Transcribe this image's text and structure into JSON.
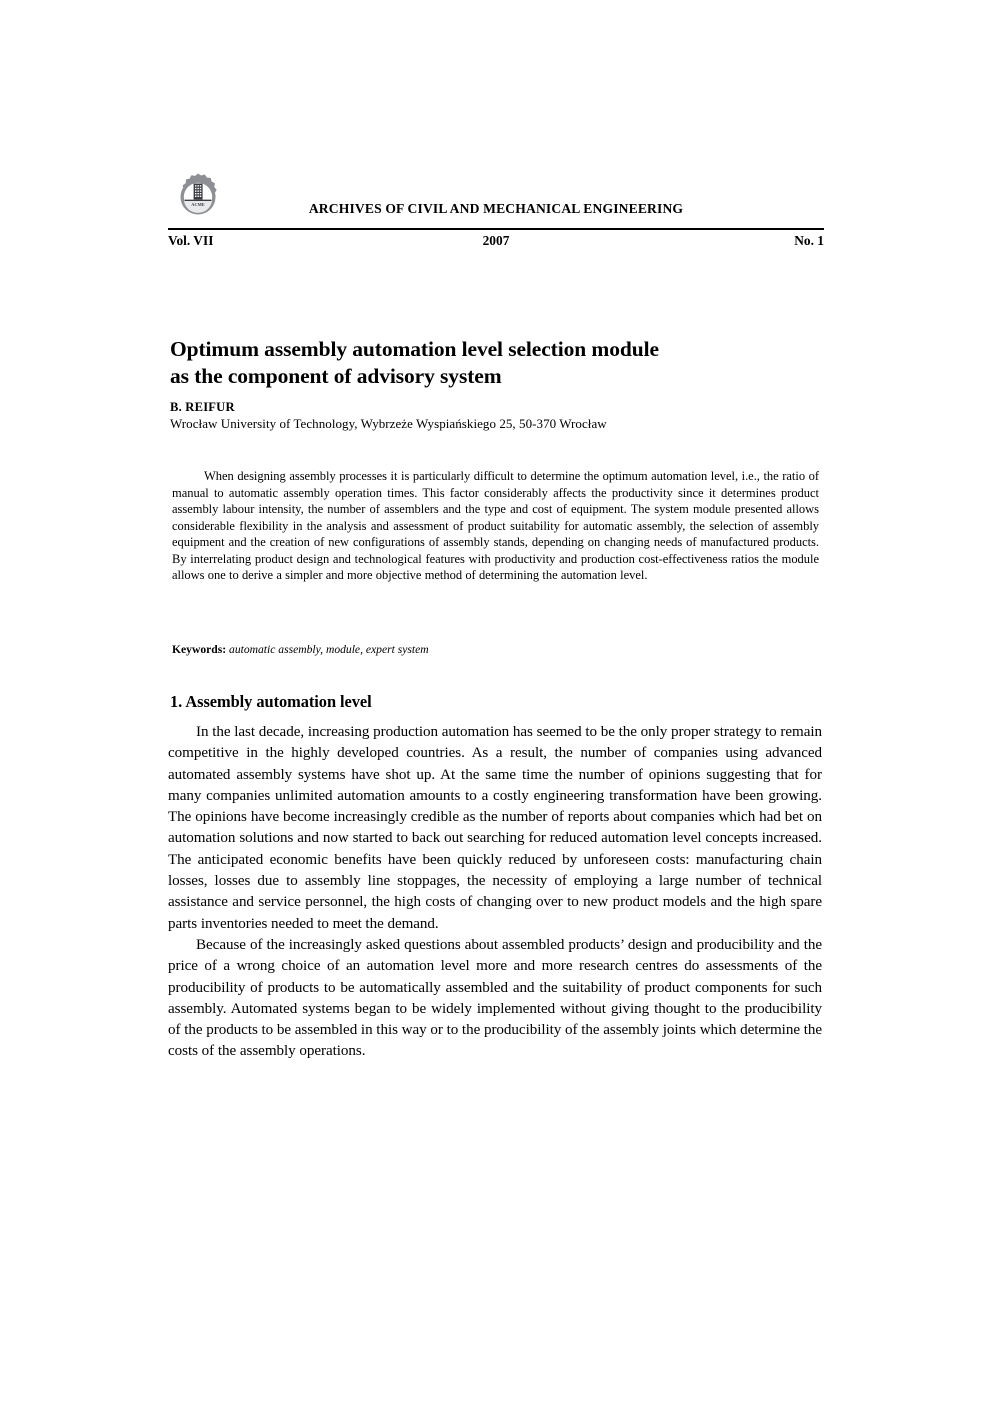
{
  "journal": {
    "logo_alt": "acme-gear-building-logo",
    "title": "ARCHIVES OF CIVIL AND MECHANICAL ENGINEERING",
    "volume": "Vol. VII",
    "year": "2007",
    "issue": "No. 1"
  },
  "article": {
    "title_line1": "Optimum assembly automation level selection module",
    "title_line2": "as the component of advisory system",
    "author": "B. REIFUR",
    "affiliation": "Wrocław University of Technology, Wybrzeże Wyspiańskiego 25, 50-370 Wrocław",
    "abstract": "When designing assembly processes it is particularly difficult to determine the optimum automation level, i.e., the ratio of manual to automatic assembly operation times. This factor considerably affects the productivity since it determines product assembly labour intensity, the number of assemblers and the type and cost of equipment. The system module presented allows considerable flexibility in the analysis and assessment of product suitability for automatic assembly, the selection of assembly equipment and the creation of new configurations of assembly stands, depending on changing needs of manufactured products. By interrelating product design and technological features with productivity and production cost-effectiveness ratios the module allows one to derive a simpler and more objective method of determining the automation level.",
    "keywords_label": "Keywords:",
    "keywords_list": "automatic assembly, module, expert system"
  },
  "sections": [
    {
      "heading": "1. Assembly automation level",
      "paragraphs": [
        "In the last decade, increasing production automation has seemed to be the only proper strategy to remain competitive in the highly developed countries. As a result, the number of companies using advanced automated assembly systems have shot up. At the same time the number of opinions suggesting that for many companies unlimited automation amounts to a costly engineering transformation have been growing. The opinions have become increasingly credible as the number of reports about companies which had bet on automation solutions and now started to back out searching for reduced automation level concepts increased. The anticipated economic benefits have been quickly reduced by unforeseen costs: manufacturing chain losses, losses due to assembly line stoppages, the necessity of employing a large number of technical assistance and service personnel, the high costs of changing over to new product models and the high spare parts inventories needed to meet the demand.",
        "Because of the increasingly asked questions about assembled products’ design and producibility and the price of a wrong choice of an automation level more and more research centres do assessments of the producibility of products to be automatically assembled and the suitability of product components for such assembly. Automated systems began to be widely implemented without giving thought to the producibility of the products to be assembled in this way or to the producibility of the assembly joints which determine the costs of the assembly operations."
      ]
    }
  ],
  "colors": {
    "text": "#000000",
    "page_background": "#ffffff",
    "logo_gray": "#8d8f94",
    "logo_dark": "#3b3d42"
  }
}
